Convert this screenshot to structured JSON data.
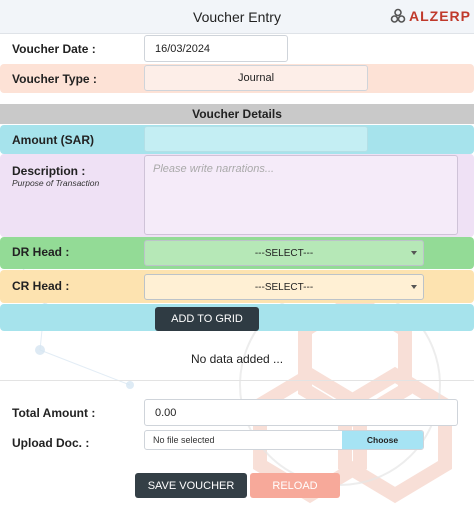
{
  "header": {
    "title": "Voucher Entry",
    "logo_text": "ALZERP"
  },
  "form": {
    "voucher_date": {
      "label": "Voucher Date :",
      "value": "16/03/2024"
    },
    "voucher_type": {
      "label": "Voucher Type :",
      "value": "Journal"
    }
  },
  "details": {
    "title": "Voucher Details",
    "amount": {
      "label": "Amount (SAR)",
      "value": ""
    },
    "description": {
      "label": "Description :",
      "sublabel": "Purpose of Transaction",
      "placeholder": "Please write narrations..."
    },
    "dr_head": {
      "label": "DR Head :",
      "selected": "---SELECT---"
    },
    "cr_head": {
      "label": "CR Head :",
      "selected": "---SELECT---"
    },
    "add_button": "ADD TO GRID"
  },
  "grid": {
    "empty_text": "No data added ..."
  },
  "footer": {
    "total_amount": {
      "label": "Total Amount :",
      "value": "0.00"
    },
    "upload": {
      "label": "Upload Doc. :",
      "status": "No file selected",
      "choose_label": "Choose"
    },
    "save_button": "SAVE VOUCHER",
    "reload_button": "RELOAD"
  },
  "colors": {
    "voucher_type_row": "#fde2d6",
    "details_bar": "#c9c9c9",
    "amount_row": "#a6e3ec",
    "description_row": "#efe1f5",
    "dr_row": "#93db96",
    "cr_row": "#fde3b0",
    "dark_button": "#343f46",
    "reload_button": "#f7a99a",
    "brand_red": "#c0392b"
  }
}
